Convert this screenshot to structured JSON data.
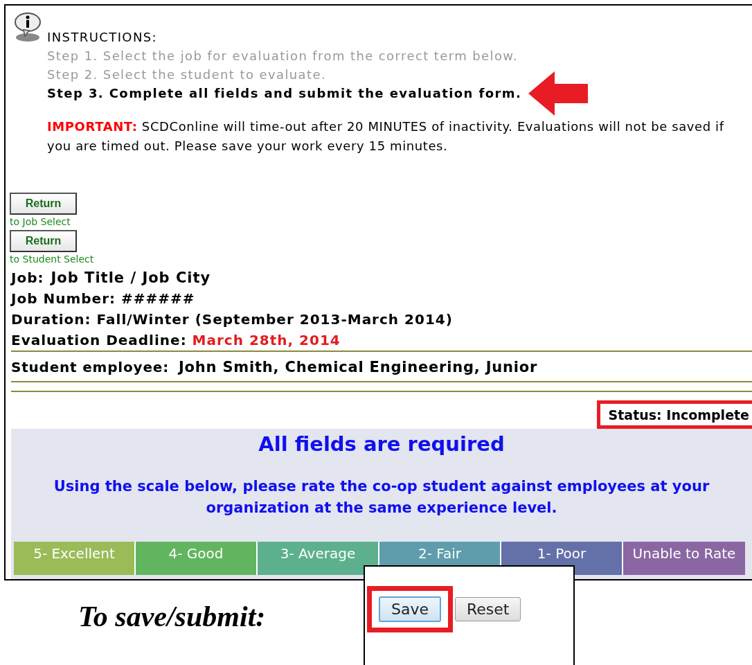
{
  "instructions": {
    "heading": "INSTRUCTIONS:",
    "steps": [
      {
        "text": "Step 1. Select the job for evaluation from the correct term below.",
        "current": false
      },
      {
        "text": "Step 2. Select the student to evaluate.",
        "current": false
      },
      {
        "text": "Step 3. Complete all fields and submit the evaluation form.",
        "current": true
      }
    ],
    "important_label": "IMPORTANT:",
    "important_text": "SCDConline will time-out after 20 MINUTES of inactivity. Evaluations will not be saved if you are timed out. Please save your work every 15 minutes."
  },
  "return_buttons": [
    {
      "label": "Return",
      "caption": "to Job Select"
    },
    {
      "label": "Return",
      "caption": "to Student Select"
    }
  ],
  "job": {
    "label": "Job:",
    "title": "Job Title / Job City",
    "number": "Job Number: ######",
    "duration": "Duration: Fall/Winter (September 2013-March 2014)",
    "deadline_label": "Evaluation Deadline:",
    "deadline": "March 28th, 2014"
  },
  "student": {
    "label": "Student employee:",
    "value": "John Smith, Chemical Engineering, Junior"
  },
  "status": "Status: Incomplete",
  "form": {
    "heading": "All fields are required",
    "instruction": "Using the scale below, please rate the co-op student against employees at your organization at the same experience level.",
    "scale": [
      {
        "label": "5- Excellent",
        "color": "#9bbb59"
      },
      {
        "label": "4- Good",
        "color": "#62b55f"
      },
      {
        "label": "3- Average",
        "color": "#5cb08e"
      },
      {
        "label": "2- Fair",
        "color": "#5f9dac"
      },
      {
        "label": "1- Poor",
        "color": "#6470a8"
      },
      {
        "label": "Unable to Rate",
        "color": "#8a67a2"
      }
    ]
  },
  "caption": "To save/submit:",
  "actions": [
    {
      "label": "Save",
      "highlighted": true
    },
    {
      "label": "Reset",
      "highlighted": false
    }
  ]
}
